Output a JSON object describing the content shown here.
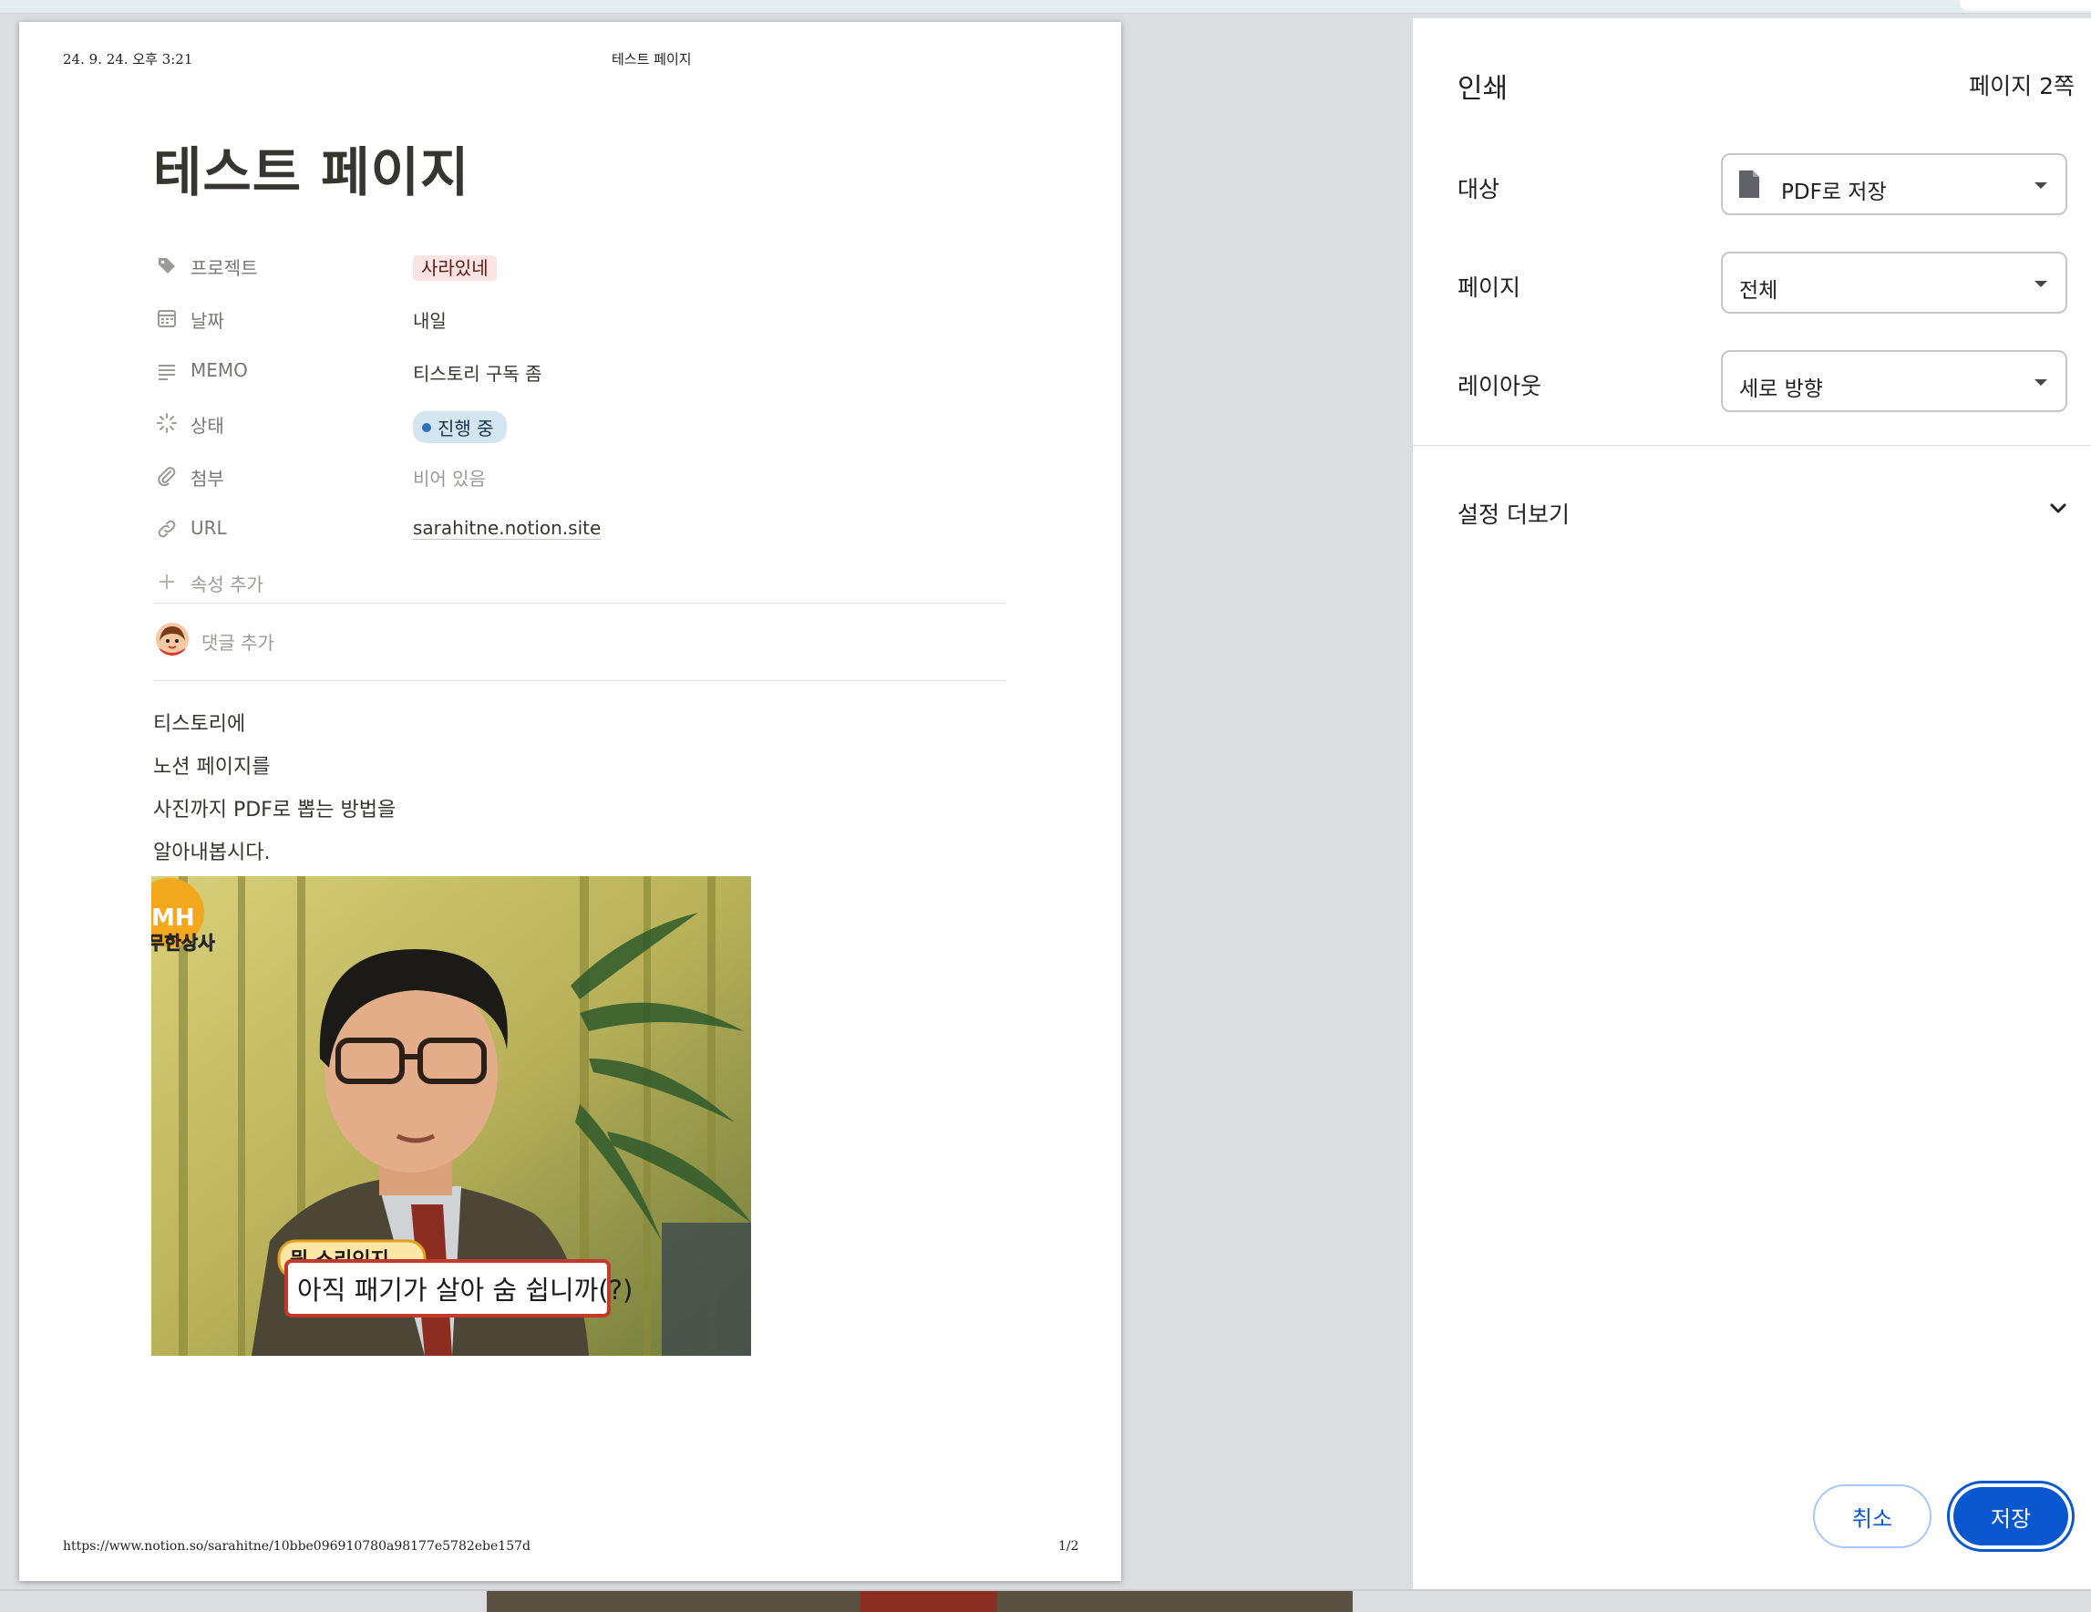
{
  "preview": {
    "header_date": "24. 9. 24. 오후 3:21",
    "header_title": "테스트 페이지",
    "footer_url": "https://www.notion.so/sarahitne/10bbe096910780a98177e5782ebe157d",
    "footer_page": "1/2",
    "doc_title": "테스트 페이지",
    "properties": {
      "project": {
        "name": "프로젝트",
        "value": "사라있네",
        "icon": "tag-icon"
      },
      "date": {
        "name": "날짜",
        "value": "내일",
        "icon": "calendar-icon"
      },
      "memo": {
        "name": "MEMO",
        "value": "티스토리 구독 좀",
        "icon": "text-lines-icon"
      },
      "status": {
        "name": "상태",
        "value": "진행 중",
        "icon": "status-spinner-icon"
      },
      "attachment": {
        "name": "첨부",
        "value": "비어 있음",
        "icon": "paperclip-icon"
      },
      "url": {
        "name": "URL",
        "value": "sarahitne.notion.site",
        "icon": "link-icon"
      }
    },
    "add_property": "속성 추가",
    "add_comment": "댓글 추가",
    "body_lines": [
      "티스토리에",
      "노션 페이지를",
      "사진까지 PDF로 뽑는 방법을",
      "알아내봅시다."
    ],
    "image": {
      "logo_text": "MH",
      "corner_caption": "무한상사",
      "caption_small": "뭔 소리인지...",
      "caption_main": "아직 패기가 살아 숨 쉽니까(?)"
    }
  },
  "dialog": {
    "title": "인쇄",
    "page_count": "페이지 2쪽",
    "destination": {
      "label": "대상",
      "value": "PDF로 저장",
      "icon": "file-icon"
    },
    "pages": {
      "label": "페이지",
      "value": "전체"
    },
    "layout": {
      "label": "레이아웃",
      "value": "세로 방향"
    },
    "more_settings": "설정 더보기",
    "cancel_label": "취소",
    "save_label": "저장"
  },
  "colors": {
    "accent": "#0b57d0",
    "tag_red_bg": "#fbe4e4",
    "status_bg": "#d3e5ef",
    "status_dot": "#2b74b9",
    "backdrop": "#dcdde1"
  }
}
